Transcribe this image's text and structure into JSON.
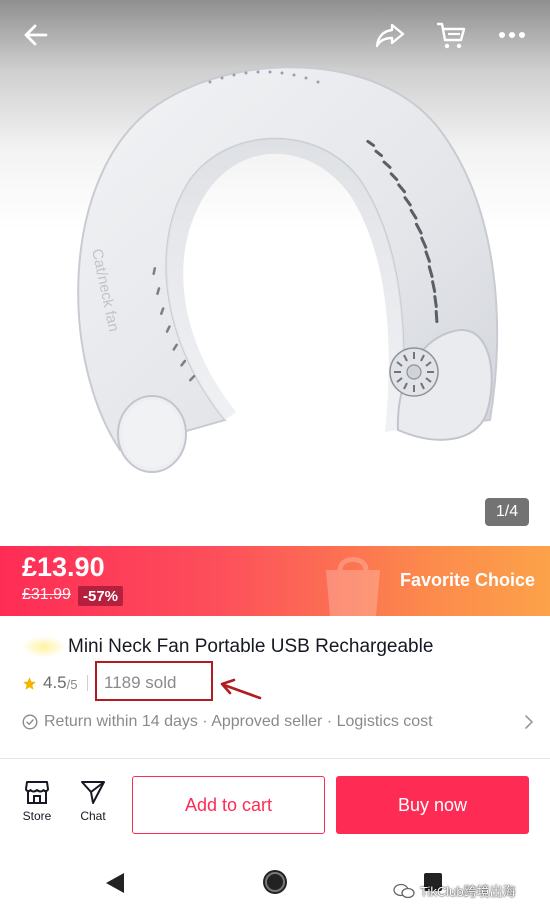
{
  "colors": {
    "accent": "#fe2c55",
    "banner_end": "#fca24a",
    "annotation": "#b01c22",
    "star": "#f5b400"
  },
  "header": {
    "icons": [
      "back-arrow-icon",
      "share-icon",
      "cart-icon",
      "more-icon"
    ]
  },
  "gallery": {
    "page_counter": "1/4",
    "image_brand_text": "Cat/neck fan"
  },
  "price": {
    "current": "£13.90",
    "original": "£31.99",
    "discount": "-57%",
    "badge": "Favorite Choice"
  },
  "product": {
    "title": "Mini Neck Fan Portable USB Rechargeable",
    "rating": "4.5",
    "rating_max": "/5",
    "sold": "1189 sold",
    "services": "Return within 14 days · Approved seller · Logistics cost"
  },
  "actions": {
    "store_label": "Store",
    "chat_label": "Chat",
    "add_to_cart": "Add to cart",
    "buy_now": "Buy now"
  },
  "watermark": {
    "text": "TikClub跨境出海"
  }
}
